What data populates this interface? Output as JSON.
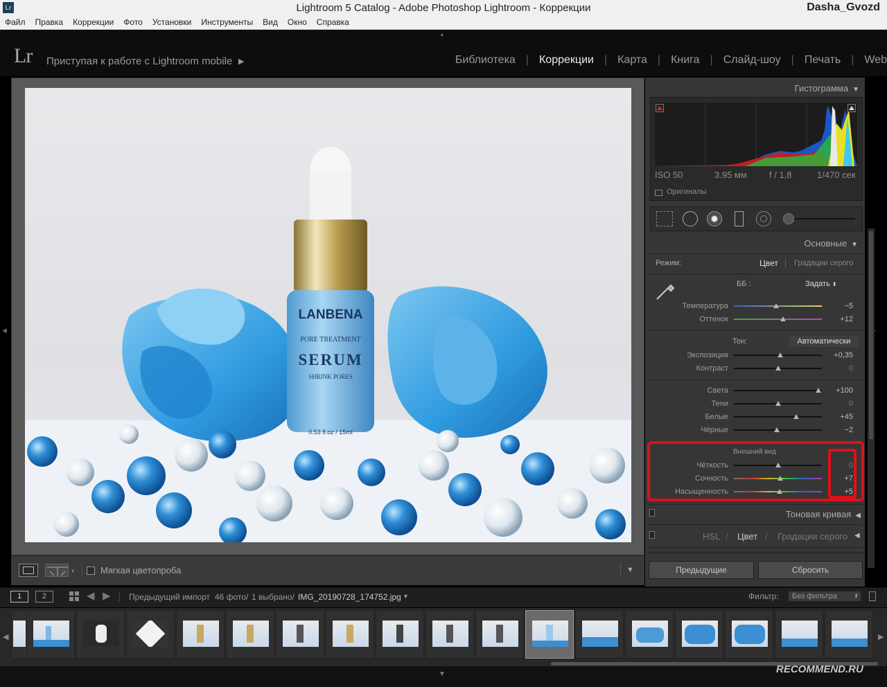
{
  "window": {
    "title": "Lightroom 5 Catalog - Adobe Photoshop Lightroom - Коррекции",
    "user": "Dasha_Gvozd",
    "app_icon": "Lr"
  },
  "menu": [
    "Файл",
    "Правка",
    "Коррекции",
    "Фото",
    "Установки",
    "Инструменты",
    "Вид",
    "Окно",
    "Справка"
  ],
  "identity": {
    "logo": "Lr",
    "text": "Приступая к работе с Lightroom mobile",
    "arrow": "▶"
  },
  "modules": [
    "Библиотека",
    "Коррекции",
    "Карта",
    "Книга",
    "Слайд-шоу",
    "Печать",
    "Web"
  ],
  "active_module": "Коррекции",
  "photo": {
    "brand": "LANBENA",
    "line1": "PORE TREATMENT",
    "line2": "SERUM",
    "line3": "SHRINK PORES",
    "volume": "0.53 fl.oz / 15ml"
  },
  "toolbar": {
    "soft_proof": "Мягкая цветопроба"
  },
  "histogram": {
    "title": "Гистограмма",
    "iso": "ISO 50",
    "focal": "3.95 мм",
    "aperture": "f / 1,8",
    "shutter": "1/470 сек",
    "originals": "Оригиналы"
  },
  "basic": {
    "title": "Основные",
    "mode_label": "Режим:",
    "mode_color": "Цвет",
    "mode_gray": "Градации серого",
    "wb_label": "ББ :",
    "wb_value": "Задать",
    "tone_label": "Тон:",
    "auto": "Автоматически",
    "presence_title": "Внешний вид",
    "sliders": {
      "temp": {
        "label": "Температура",
        "value": "−5",
        "level": 0.48
      },
      "tint": {
        "label": "Оттенок",
        "value": "+12",
        "level": 0.56
      },
      "exposure": {
        "label": "Экспозиция",
        "value": "+0,35",
        "level": 0.53
      },
      "contrast": {
        "label": "Контраст",
        "value": "0",
        "level": 0.5
      },
      "high": {
        "label": "Света",
        "value": "+100",
        "level": 0.96
      },
      "shadow": {
        "label": "Тени",
        "value": "0",
        "level": 0.5
      },
      "white": {
        "label": "Белые",
        "value": "+45",
        "level": 0.71
      },
      "black": {
        "label": "Чёрные",
        "value": "−2",
        "level": 0.49
      },
      "clarity": {
        "label": "Чёткость",
        "value": "0",
        "level": 0.5
      },
      "vibrance": {
        "label": "Сочность",
        "value": "+7",
        "level": 0.53
      },
      "sat": {
        "label": "Насыщенность",
        "value": "+5",
        "level": 0.52
      }
    }
  },
  "tone_curve": {
    "title": "Тоновая кривая"
  },
  "hsl": {
    "hsl": "HSL",
    "color": "Цвет",
    "gray": "Градации серого"
  },
  "buttons": {
    "prev": "Предыдущие",
    "reset": "Сбросить"
  },
  "filmbar": {
    "page1": "1",
    "page2": "2",
    "source": "Предыдущий импорт",
    "count": "46 фото/",
    "selected": "1 выбрано/",
    "file": "IMG_20190728_174752.jpg",
    "filter_label": "Фильтр:",
    "filter_value": "Без фильтра"
  },
  "watermark": "RECOMMEND.RU",
  "colors": {
    "highlight": "#e0101a",
    "accent_blue": "#3a9ad8"
  }
}
